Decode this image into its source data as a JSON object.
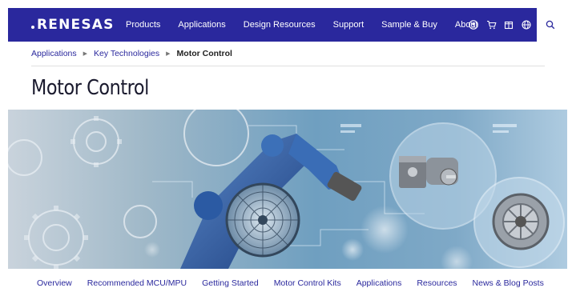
{
  "header": {
    "logo_text": "RENESAS",
    "nav_items": [
      "Products",
      "Applications",
      "Design Resources",
      "Support",
      "Sample & Buy",
      "About"
    ],
    "icons": [
      "user-icon",
      "cart-icon",
      "box-icon",
      "globe-icon",
      "search-icon"
    ],
    "brand_color": "#2a289d"
  },
  "breadcrumb": {
    "items": [
      "Applications",
      "Key Technologies"
    ],
    "current": "Motor Control"
  },
  "page": {
    "title": "Motor Control"
  },
  "hero": {
    "description_icon": "motor-control-hero-image"
  },
  "subnav": {
    "items": [
      "Overview",
      "Recommended MCU/MPU",
      "Getting Started",
      "Motor Control Kits",
      "Applications",
      "Resources",
      "News & Blog Posts"
    ]
  }
}
